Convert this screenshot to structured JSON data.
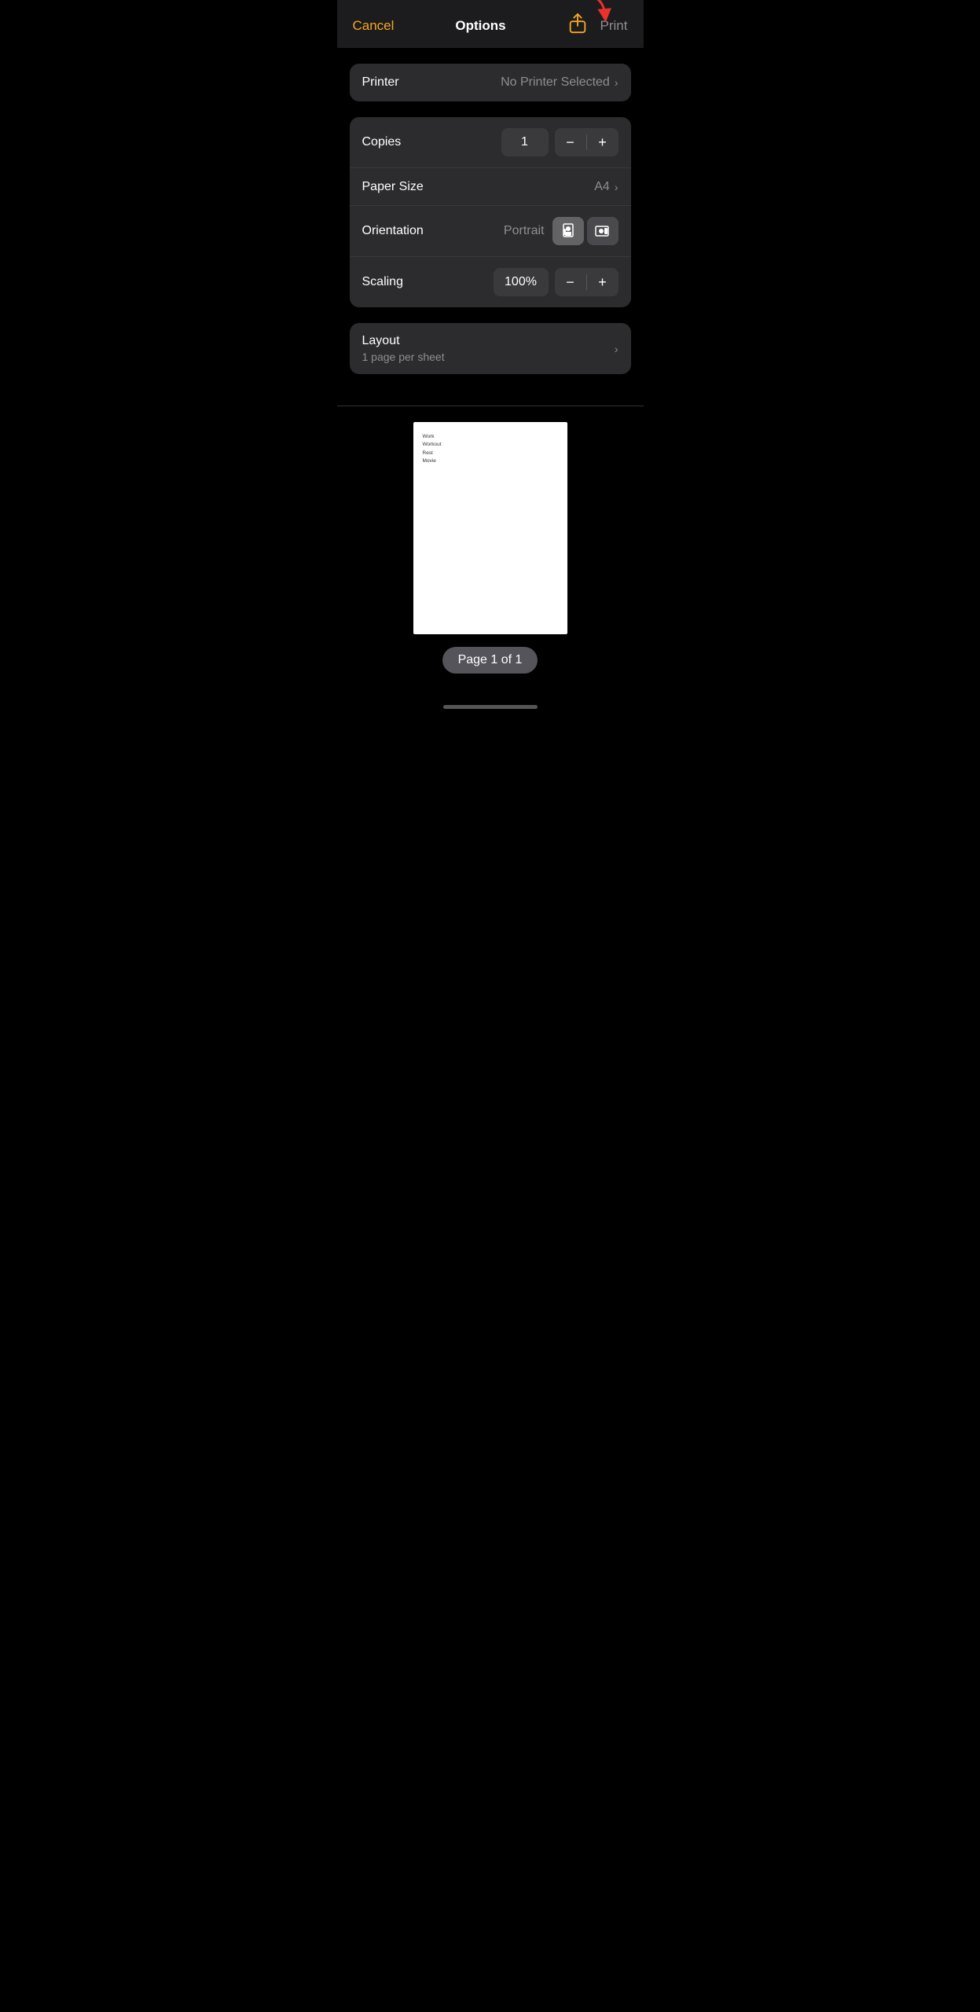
{
  "nav": {
    "cancel_label": "Cancel",
    "title": "Options",
    "print_label": "Print"
  },
  "printer": {
    "label": "Printer",
    "value": "No Printer Selected"
  },
  "copies": {
    "label": "Copies",
    "value": "1"
  },
  "paper_size": {
    "label": "Paper Size",
    "value": "A4"
  },
  "orientation": {
    "label": "Orientation",
    "value": "Portrait"
  },
  "scaling": {
    "label": "Scaling",
    "value": "100%"
  },
  "layout": {
    "label": "Layout",
    "subtitle": "1 page per sheet"
  },
  "preview": {
    "lines": [
      "Work",
      "Workout",
      "Rest",
      "Movie"
    ],
    "page_badge": "Page 1 of 1"
  },
  "icons": {
    "share": "share-icon",
    "chevron_right": "›",
    "minus": "−",
    "plus": "+"
  }
}
